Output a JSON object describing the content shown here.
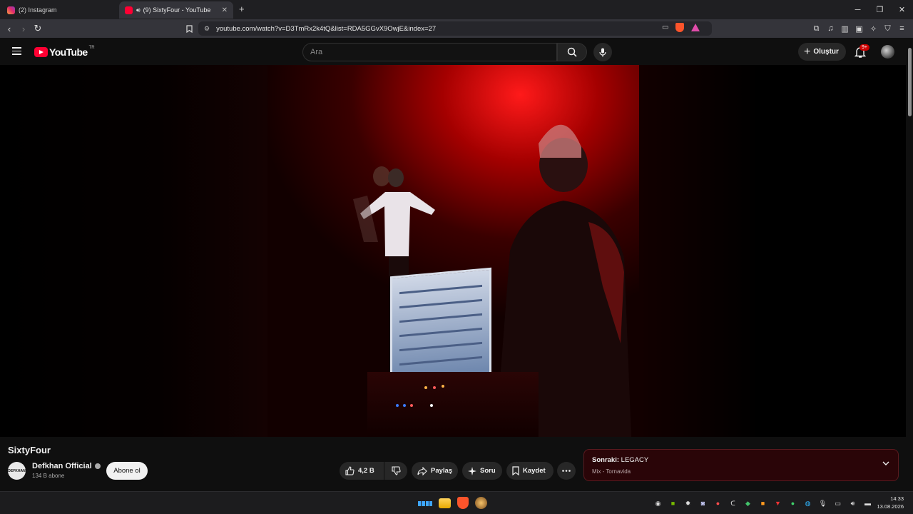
{
  "browser": {
    "tabs": [
      {
        "label": "(2) Instagram",
        "active": false,
        "favicon": "instagram-icon"
      },
      {
        "label": "(9) SixtyFour - YouTube",
        "active": true,
        "favicon": "youtube-icon"
      }
    ],
    "url": "youtube.com/watch?v=D3TmRx2k4tQ&list=RDA5GGvX9OwjE&index=27"
  },
  "youtube": {
    "logo_text": "YouTube",
    "country_code": "TR",
    "search_placeholder": "Ara",
    "create_label": "Oluştur",
    "notification_badge": "9+"
  },
  "video": {
    "title": "SixtyFour",
    "channel": "Defkhan Official",
    "channel_avatar_text": "DEFKHAN",
    "subscribers": "134 B abone",
    "subscribe_label": "Abone ol",
    "likes": "4,2 B",
    "share_label": "Paylaş",
    "ask_label": "Soru",
    "save_label": "Kaydet"
  },
  "up_next": {
    "prefix": "Sonraki:",
    "title": "LEGACY",
    "subtitle": "Mix - Tornavida"
  },
  "taskbar": {
    "time": "14:33",
    "date": "13.08.2026"
  },
  "colors": {
    "youtube_red": "#ff0033",
    "accent_blue": "#3ea6ff",
    "upnext_bg": "#2a0508"
  }
}
